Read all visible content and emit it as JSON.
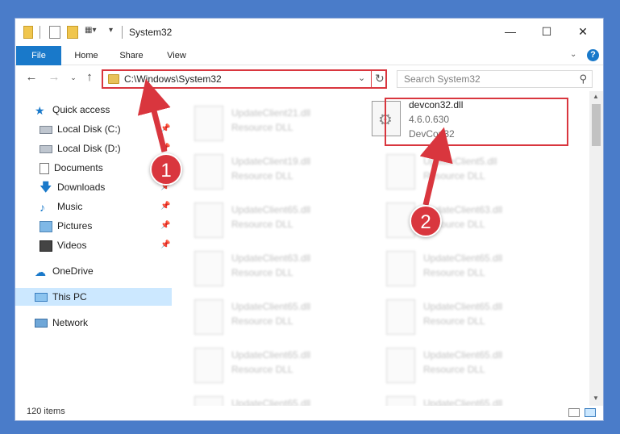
{
  "window": {
    "title": "System32"
  },
  "ribbon": {
    "tabs": [
      "File",
      "Home",
      "Share",
      "View"
    ]
  },
  "address": {
    "path": "C:\\Windows\\System32"
  },
  "search": {
    "placeholder": "Search System32"
  },
  "nav": {
    "items": [
      {
        "label": "Quick access",
        "icon": "star-icon"
      },
      {
        "label": "Local Disk (C:)",
        "icon": "drive-icon",
        "pinned": true
      },
      {
        "label": "Local Disk (D:)",
        "icon": "drive-icon",
        "pinned": true
      },
      {
        "label": "Documents",
        "icon": "document-icon",
        "pinned": true
      },
      {
        "label": "Downloads",
        "icon": "download-icon",
        "pinned": true
      },
      {
        "label": "Music",
        "icon": "music-icon",
        "pinned": true
      },
      {
        "label": "Pictures",
        "icon": "picture-icon",
        "pinned": true
      },
      {
        "label": "Videos",
        "icon": "video-icon",
        "pinned": true
      },
      {
        "label": "OneDrive",
        "icon": "cloud-icon"
      },
      {
        "label": "This PC",
        "icon": "computer-icon",
        "selected": true
      },
      {
        "label": "Network",
        "icon": "network-icon"
      }
    ]
  },
  "files": {
    "left": [
      {
        "name": "UpdateClient21.dll",
        "type": "Resource DLL"
      },
      {
        "name": "UpdateClient19.dll",
        "type": "Resource DLL"
      },
      {
        "name": "UpdateClient65.dll",
        "type": "Resource DLL"
      },
      {
        "name": "UpdateClient63.dll",
        "type": "Resource DLL"
      },
      {
        "name": "UpdateClient65.dll",
        "type": "Resource DLL"
      },
      {
        "name": "UpdateClient65.dll",
        "type": "Resource DLL"
      },
      {
        "name": "UpdateClient65.dll",
        "type": "Resource DLL"
      }
    ],
    "right_highlight": {
      "name": "devcon32.dll",
      "version": "4.6.0.630",
      "description": "DevCon32"
    },
    "right": [
      {
        "name": "UpdateClient5.dll",
        "type": "Resource DLL"
      },
      {
        "name": "UpdateClient63.dll",
        "type": "Resource DLL"
      },
      {
        "name": "UpdateClient65.dll",
        "type": "Resource DLL"
      },
      {
        "name": "UpdateClient65.dll",
        "type": "Resource DLL"
      },
      {
        "name": "UpdateClient65.dll",
        "type": "Resource DLL"
      },
      {
        "name": "UpdateClient65.dll",
        "type": "Resource DLL"
      }
    ]
  },
  "status": {
    "count": "120 items"
  },
  "callouts": [
    "1",
    "2"
  ],
  "colors": {
    "accent": "#1979ca",
    "highlight": "#d9363e",
    "selection": "#cce8ff"
  }
}
